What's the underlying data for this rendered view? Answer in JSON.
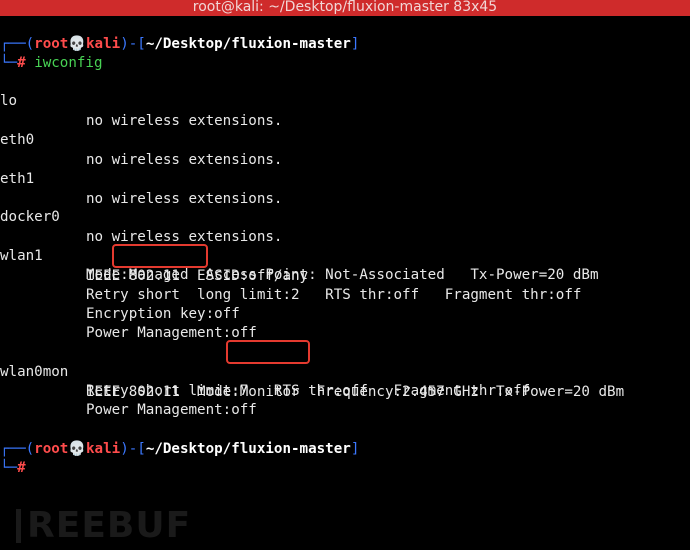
{
  "window": {
    "title": "root@kali: ~/Desktop/fluxion-master 83x45"
  },
  "prompt1": {
    "tl": "┌──(",
    "user": "root",
    "skull": "💀",
    "host": "kali",
    "sep": ")-[",
    "path": "~/Desktop/fluxion-master",
    "end": "]",
    "bl": "└─",
    "hash": "# ",
    "command": "iwconfig"
  },
  "output": {
    "lo": {
      "iface": "lo",
      "text": "no wireless extensions."
    },
    "eth0": {
      "iface": "eth0",
      "text": "no wireless extensions."
    },
    "eth1": {
      "iface": "eth1",
      "text": "no wireless extensions."
    },
    "docker0": {
      "iface": "docker0",
      "text": "no wireless extensions."
    },
    "wlan1": {
      "iface": "wlan1",
      "l1": "IEEE 802.11  ESSID:off/any",
      "l2": "Mode:Managed  Access Point: Not-Associated   Tx-Power=20 dBm",
      "l3": "Retry short  long limit:2   RTS thr:off   Fragment thr:off",
      "l4": "Encryption key:off",
      "l5": "Power Management:off"
    },
    "wlan0mon": {
      "iface": "wlan0mon",
      "l1": "IEEE 802.11  Mode:Monitor  Frequency:2.457 GHz  Tx-Power=20 dBm",
      "l2": "Retry short limit:7   RTS thr:off   Fragment thr:off",
      "l3": "Power Management:off"
    }
  },
  "prompt2": {
    "tl": "┌──(",
    "user": "root",
    "skull": "💀",
    "host": "kali",
    "sep": ")-[",
    "path": "~/Desktop/fluxion-master",
    "end": "]",
    "bl": "└─",
    "hash": "#"
  },
  "watermark": {
    "text": "REEBUF"
  },
  "colors": {
    "titlebar": "#cf2b2b",
    "highlight": "#e43a2f",
    "prompt_blue": "#3b78ff",
    "prompt_red": "#ff4c4c",
    "command_green": "#48d254"
  }
}
